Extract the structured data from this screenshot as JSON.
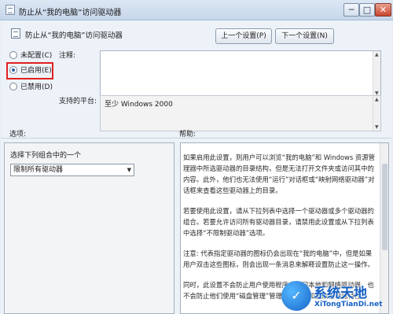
{
  "window": {
    "title": "防止从“我的电脑”访问驱动器",
    "controls": {
      "minimize": "─",
      "maximize": "□",
      "close": "✕"
    }
  },
  "header": {
    "policy_name": "防止从“我的电脑”访问驱动器",
    "prev_button": "上一个设置(P)",
    "next_button": "下一个设置(N)"
  },
  "state": {
    "options": [
      {
        "label": "未配置(C)",
        "selected": false
      },
      {
        "label": "已启用(E)",
        "selected": true
      },
      {
        "label": "已禁用(D)",
        "selected": false
      }
    ],
    "highlight_color": "#e02020"
  },
  "comment": {
    "label": "注释:",
    "value": ""
  },
  "platform": {
    "label": "支持的平台:",
    "value": "至少 Windows 2000"
  },
  "options_section": {
    "label": "选项:",
    "caption": "选择下列组合中的一个",
    "selected": "限制所有驱动器"
  },
  "help_section": {
    "label": "帮助:",
    "paragraphs": [
      "如果启用此设置，则用户可以浏览“我的电脑”和 Windows 资源管理器中所选驱动器的目录结构，但是无法打开文件夹或访问其中的内容。此外，他们也无法使用“运行”对话框或“映射网络驱动器”对话框来查看这些驱动器上的目录。",
      "若要使用此设置，请从下拉列表中选择一个驱动器或多个驱动器的组合。若要允许访问所有驱动器目录，请禁用此设置或从下拉列表中选择“不限制驱动器”选项。",
      "注意: 代表指定驱动器的图标仍会出现在“我的电脑”中，但是如果用户双击这些图标，则会出现一条消息来解释设置防止这一操作。",
      "同时，此设置不会防止用户使用程序来访问本地和网络驱动器。也不会防止他们使用“磁盘管理”管理单元查看和更改驱动器特性。"
    ]
  },
  "watermark": {
    "title": "系统天地",
    "url": "XiTongTianDi.net"
  },
  "colors": {
    "accent": "#1560c4",
    "window_bg": "#edf2f8"
  }
}
